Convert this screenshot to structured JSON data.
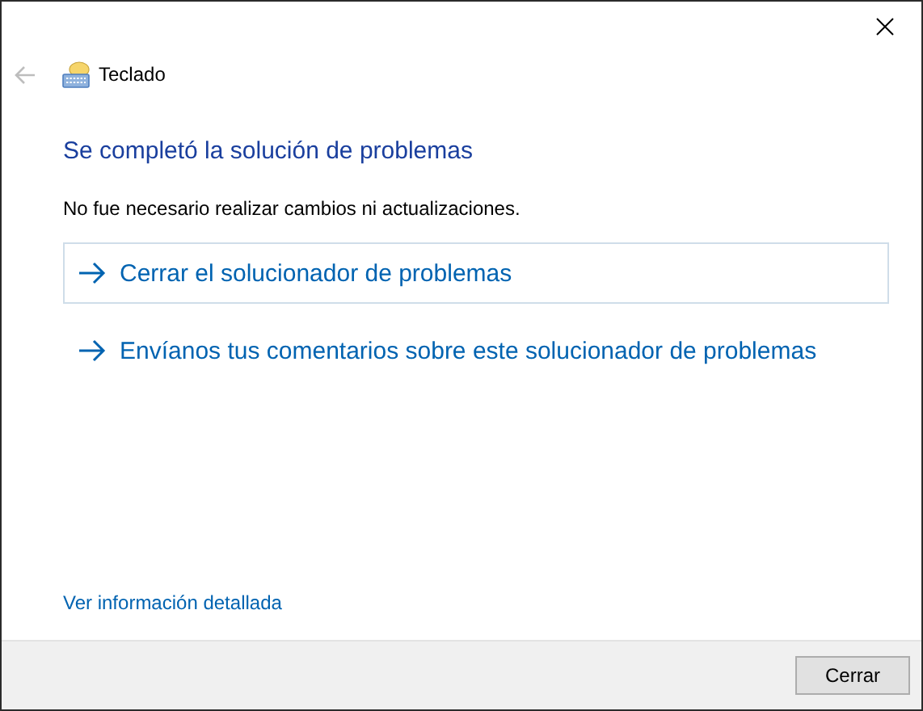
{
  "window": {
    "back_button": {
      "disabled": true
    },
    "title": "Teclado"
  },
  "heading": "Se completó la solución de problemas",
  "message": "No fue necesario realizar cambios ni actualizaciones.",
  "options": [
    {
      "label": "Cerrar el solucionador de problemas",
      "selected": true
    },
    {
      "label": "Envíanos tus comentarios sobre este solucionador de problemas",
      "selected": false
    }
  ],
  "details_link": "Ver información detallada",
  "buttons": [
    "Cerrar"
  ]
}
